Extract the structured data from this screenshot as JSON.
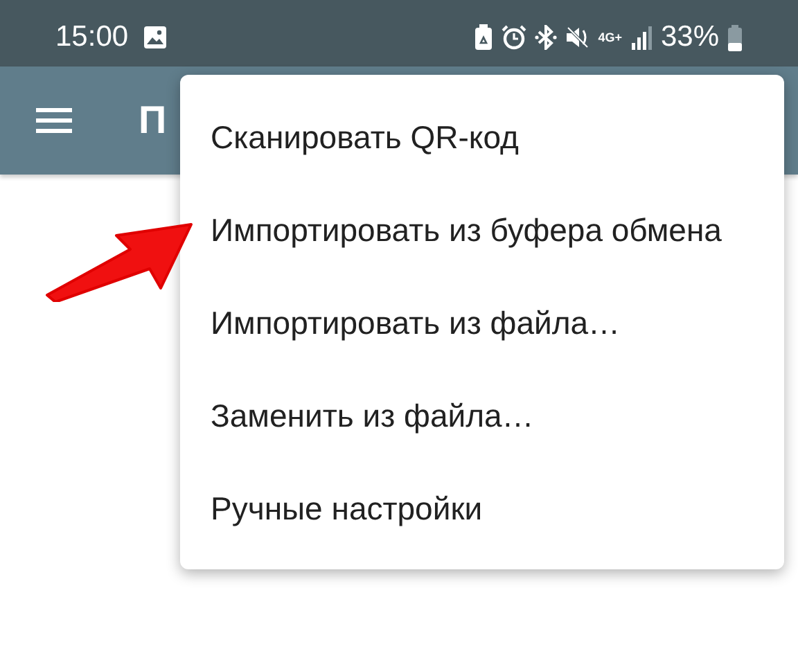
{
  "status_bar": {
    "time": "15:00",
    "network": "4G+",
    "battery": "33%"
  },
  "app_bar": {
    "title": "П"
  },
  "menu": {
    "items": [
      {
        "label": "Сканировать QR-код"
      },
      {
        "label": "Импортировать из буфера обмена"
      },
      {
        "label": "Импортировать из файла…"
      },
      {
        "label": "Заменить из файла…"
      },
      {
        "label": "Ручные настройки"
      }
    ]
  }
}
